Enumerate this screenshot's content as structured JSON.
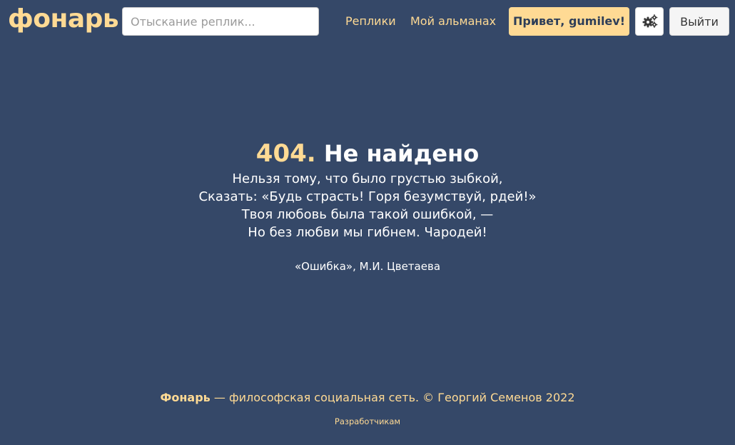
{
  "header": {
    "brand": "фонарь",
    "search_placeholder": "Отыскание реплик...",
    "nav": {
      "replies": "Реплики",
      "almanac": "Мой альманах"
    },
    "greeting": "Привет, gumilev!",
    "settings_icon": "gears-icon",
    "logout": "Выйти"
  },
  "error": {
    "code": "404.",
    "title": "Не найдено",
    "poem": [
      "Нельзя тому, что было грустью зыбкой,",
      "Сказать: «Будь страсть! Горя безумствуй, рдей!»",
      "Твоя любовь была такой ошибкой, —",
      "Но без любви мы гибнем. Чародей!"
    ],
    "attribution": "«Ошибка», М.И. Цветаева"
  },
  "footer": {
    "name": "Фонарь",
    "description": " — философская социальная сеть. © Георгий Семенов 2022",
    "developers_link": "Разработчикам"
  },
  "colors": {
    "background": "#354868",
    "accent": "#ffda94",
    "text": "#ffffff"
  }
}
